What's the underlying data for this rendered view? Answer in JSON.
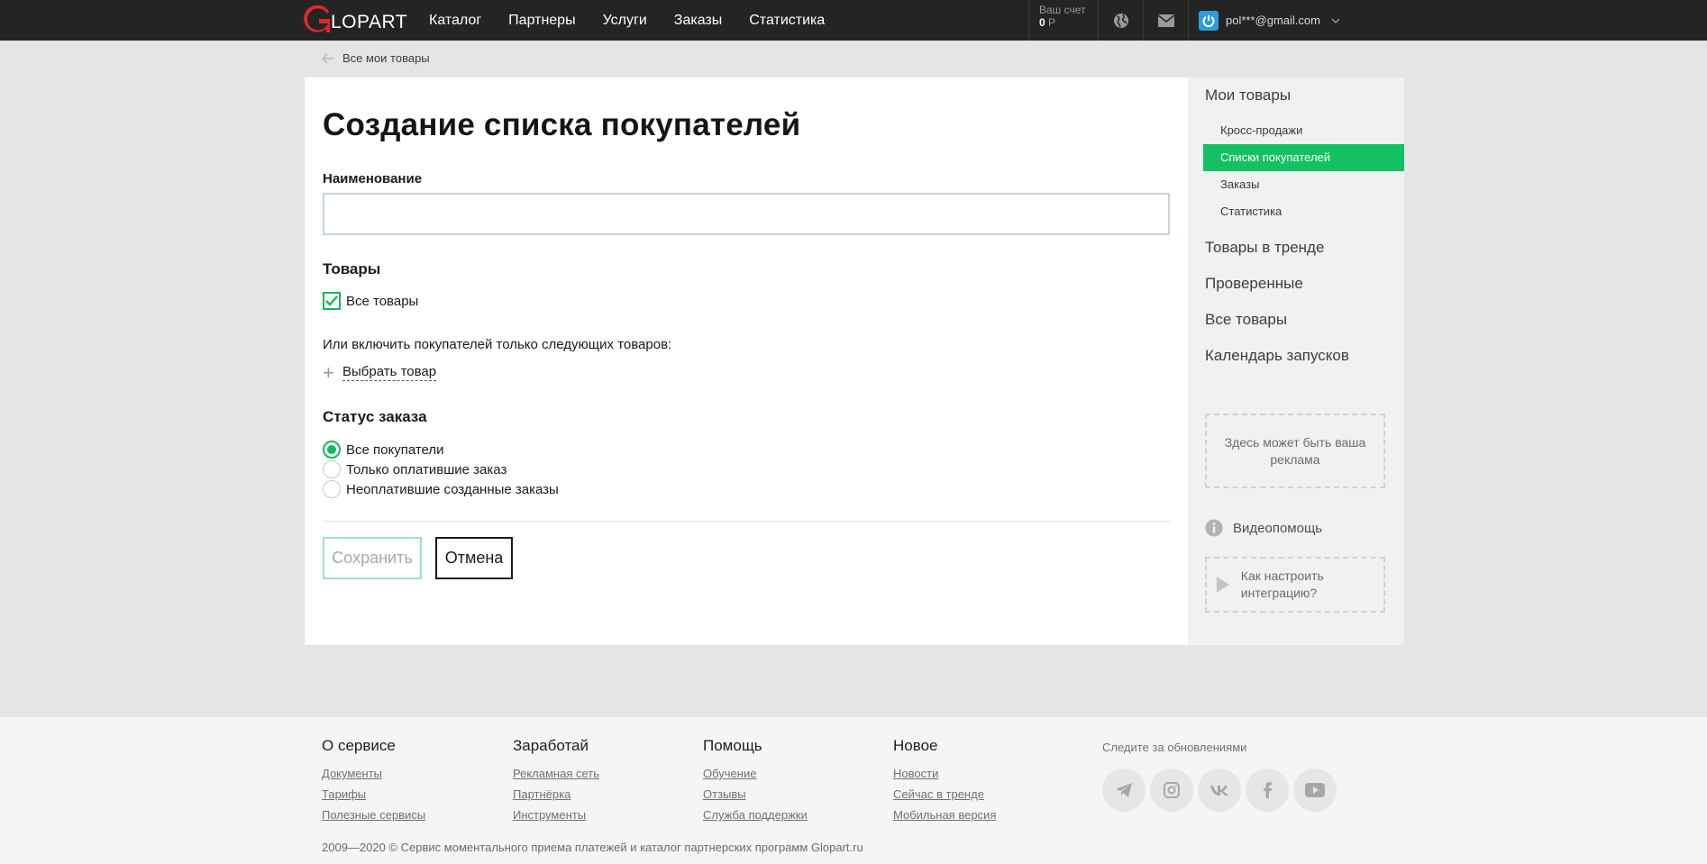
{
  "header": {
    "logo_text": "LOPART",
    "nav": [
      "Каталог",
      "Партнеры",
      "Услуги",
      "Заказы",
      "Статистика"
    ],
    "account_label": "Ваш счет",
    "balance_value": "0",
    "balance_currency": "Р",
    "user_email": "pol***@gmail.com"
  },
  "breadcrumb": {
    "back_label": "Все мои товары"
  },
  "form": {
    "title": "Создание списка покупателей",
    "name_label": "Наименование",
    "name_value": "",
    "products_title": "Товары",
    "all_products_label": "Все товары",
    "all_products_checked": true,
    "include_text": "Или включить покупателей только следующих товаров:",
    "choose_product_label": "Выбрать товар",
    "status_title": "Статус заказа",
    "status_options": [
      "Все покупатели",
      "Только оплатившие заказ",
      "Неоплатившие созданные заказы"
    ],
    "status_selected": 0,
    "save_label": "Сохранить",
    "cancel_label": "Отмена"
  },
  "sidebar": {
    "my_products": "Мои товары",
    "sub_items": [
      "Кросс-продажи",
      "Списки покупателей",
      "Заказы",
      "Статистика"
    ],
    "active_sub_index": 1,
    "sections": [
      "Товары в тренде",
      "Проверенные",
      "Все товары",
      "Календарь запусков"
    ],
    "ad_text": "Здесь может быть ваша реклама",
    "video_help": "Видеопомощь",
    "video_item": "Как настроить интеграцию?"
  },
  "footer": {
    "columns": [
      {
        "title": "О сервисе",
        "links": [
          "Документы",
          "Тарифы",
          "Полезные сервисы"
        ]
      },
      {
        "title": "Заработай",
        "links": [
          "Рекламная сеть",
          "Партнёрка",
          "Инструменты"
        ]
      },
      {
        "title": "Помощь",
        "links": [
          "Обучение",
          "Отзывы",
          "Служба поддержки"
        ]
      },
      {
        "title": "Новое",
        "links": [
          "Новости",
          "Сейчас в тренде",
          "Мобильная версия"
        ]
      }
    ],
    "follow_label": "Следите за обновлениями",
    "social_icons": [
      "telegram-icon",
      "instagram-icon",
      "vk-icon",
      "facebook-icon",
      "youtube-icon"
    ],
    "copyright": "2009—2020 © Сервис моментального приема платежей и каталог партнерских программ Glopart.ru"
  },
  "colors": {
    "accent": "#13c163",
    "topbar": "#242424",
    "logo_red": "#e3262e"
  }
}
